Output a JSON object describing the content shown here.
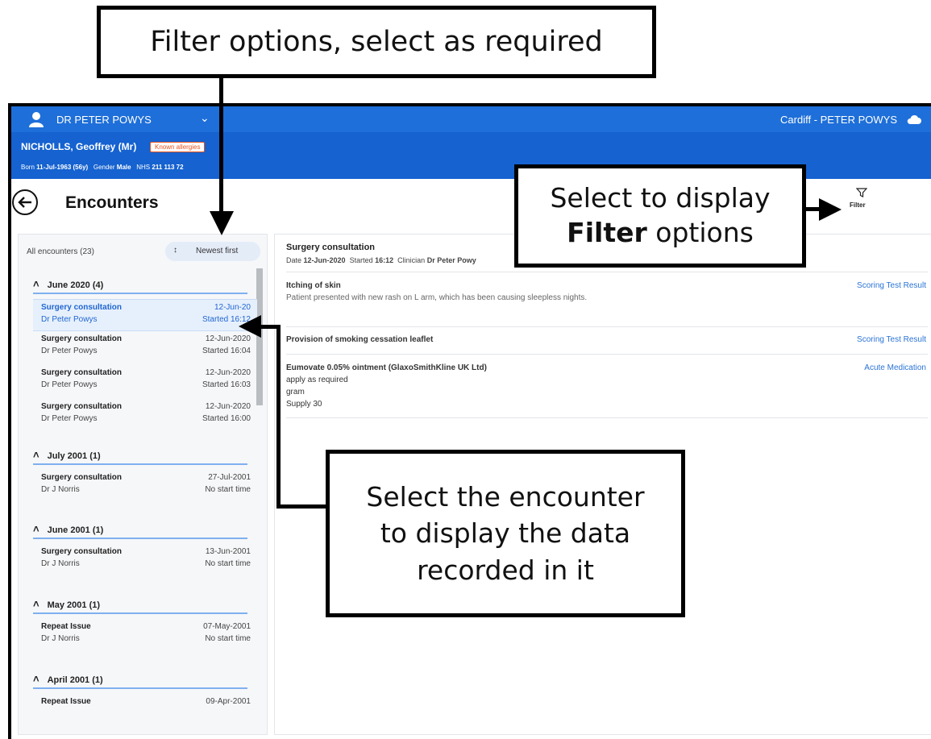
{
  "callouts": {
    "filter_options": "Filter options, select as required",
    "display_filter_line1": "Select to display",
    "display_filter_bold": "Filter",
    "display_filter_rest": " options",
    "select_encounter_line1": "Select the encounter",
    "select_encounter_line2": "to display the data",
    "select_encounter_line3": "recorded in it"
  },
  "topbar": {
    "user_name": "DR PETER POWYS",
    "location": "Cardiff - PETER POWYS"
  },
  "patient": {
    "name": "NICHOLLS, Geoffrey (Mr)",
    "allergy_badge": "Known allergies",
    "born_label": "Born",
    "born_value": "11-Jul-1963 (56y)",
    "gender_label": "Gender",
    "gender_value": "Male",
    "nhs_label": "NHS",
    "nhs_value": "211 113 72"
  },
  "page": {
    "title": "Encounters",
    "filter_label": "Filter"
  },
  "left": {
    "count_label": "All encounters (23)",
    "sort_label": "Newest first",
    "groups": [
      {
        "label": "June 2020 (4)",
        "items": [
          {
            "title": "Surgery consultation",
            "clinician": "Dr Peter Powys",
            "date": "12-Jun-20",
            "start": "Started 16:12"
          },
          {
            "title": "Surgery consultation",
            "clinician": "Dr Peter Powys",
            "date": "12-Jun-2020",
            "start": "Started 16:04"
          },
          {
            "title": "Surgery consultation",
            "clinician": "Dr Peter Powys",
            "date": "12-Jun-2020",
            "start": "Started 16:03"
          },
          {
            "title": "Surgery consultation",
            "clinician": "Dr Peter Powys",
            "date": "12-Jun-2020",
            "start": "Started 16:00"
          }
        ]
      },
      {
        "label": "July 2001 (1)",
        "items": [
          {
            "title": "Surgery consultation",
            "clinician": "Dr J Norris",
            "date": "27-Jul-2001",
            "start": "No start time"
          }
        ]
      },
      {
        "label": "June 2001 (1)",
        "items": [
          {
            "title": "Surgery consultation",
            "clinician": "Dr J Norris",
            "date": "13-Jun-2001",
            "start": "No start time"
          }
        ]
      },
      {
        "label": "May 2001 (1)",
        "items": [
          {
            "title": "Repeat Issue",
            "clinician": "Dr J Norris",
            "date": "07-May-2001",
            "start": "No start time"
          }
        ]
      },
      {
        "label": "April 2001 (1)",
        "items": [
          {
            "title": "Repeat Issue",
            "clinician": "",
            "date": "09-Apr-2001",
            "start": ""
          }
        ]
      }
    ]
  },
  "detail": {
    "title": "Surgery consultation",
    "date_label": "Date",
    "date_value": "12-Jun-2020",
    "started_label": "Started",
    "started_value": "16:12",
    "clinician_label": "Clinician",
    "clinician_value": "Dr Peter Powy",
    "entries": [
      {
        "heading": "Itching of skin",
        "text": "Patient presented with new rash on L arm, which has been causing sleepless nights.",
        "type": "Scoring Test Result"
      },
      {
        "heading": "Provision of smoking cessation leaflet",
        "type": "Scoring Test Result"
      },
      {
        "heading": "Eumovate 0.05% ointment (GlaxoSmithKline UK Ltd)",
        "line1": "apply as required",
        "line2": "gram",
        "line3": "Supply 30",
        "type": "Acute Medication"
      }
    ]
  },
  "colors": {
    "topbar": "#1e6fd9",
    "patientbar": "#1562d0",
    "accent": "#2a74d6",
    "allergy": "#e8541e"
  }
}
